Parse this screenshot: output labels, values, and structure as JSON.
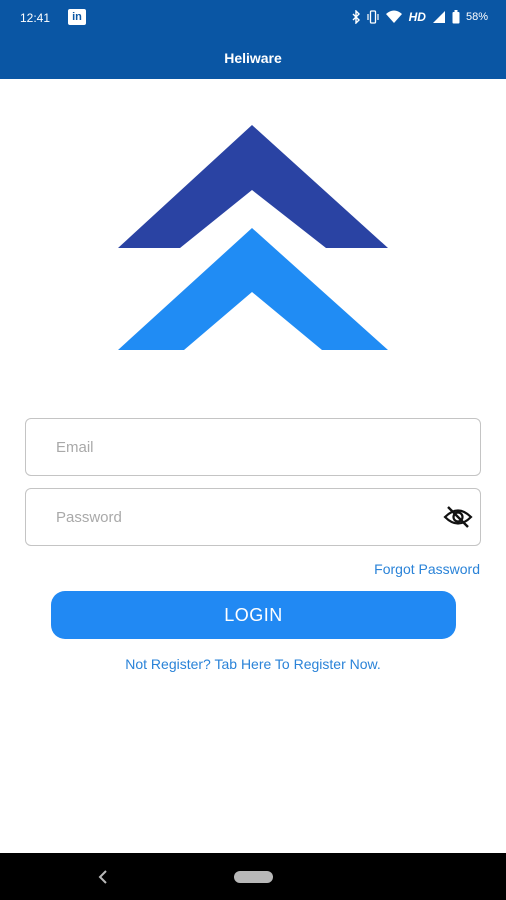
{
  "status_bar": {
    "time": "12:41",
    "linkedin_badge": "in",
    "network_label": "HD",
    "battery_percent": "58%",
    "icons": [
      "linkedin-icon",
      "bluetooth-icon",
      "vibrate-icon",
      "wifi-icon",
      "signal-icon",
      "battery-icon"
    ]
  },
  "app_bar": {
    "title": "Heliware"
  },
  "logo": {
    "icon": "heliware-logo-icon",
    "colors": {
      "upper_chevron": "#2a43a3",
      "lower_chevron": "#208cf4"
    }
  },
  "login_form": {
    "email": {
      "placeholder": "Email",
      "value": ""
    },
    "password": {
      "placeholder": "Password",
      "value": "",
      "toggle_icon": "eye-off-icon"
    },
    "forgot_password_label": "Forgot Password",
    "login_button_label": "LOGIN",
    "register_prompt": "Not Register? Tab Here To Register Now."
  },
  "nav_bar": {
    "back_icon": "back-chevron-icon",
    "home_icon": "home-pill-icon"
  },
  "colors": {
    "app_bar": "#0a56a4",
    "primary_button": "#2189f3",
    "link": "#2a83d8",
    "field_border": "#c4c4c4",
    "nav_bar": "#000000"
  }
}
